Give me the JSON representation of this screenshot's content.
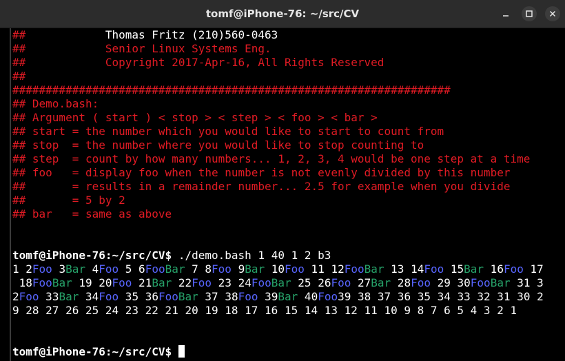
{
  "window": {
    "title": "tomf@iPhone-76: ~/src/CV"
  },
  "colors": {
    "comment_red": "#e01b24",
    "foo_blue": "#5865ff",
    "bar_green": "#26a269",
    "text_white": "#ffffff",
    "background": "#000000",
    "titlebar": "#2c2c2c"
  },
  "controls": {
    "icons": [
      "minimize-icon",
      "maximize-icon",
      "close-icon"
    ]
  },
  "terminal": {
    "lines": [
      [
        {
          "t": "##            ",
          "c": "r"
        },
        {
          "t": "Thomas Fritz (210)560-0463",
          "c": "w"
        }
      ],
      [
        {
          "t": "##            Senior Linux Systems Eng.",
          "c": "r"
        }
      ],
      [
        {
          "t": "##            Copyright 2017-Apr-16, All Rights Reserved",
          "c": "r"
        }
      ],
      [
        {
          "t": "##",
          "c": "r"
        }
      ],
      [
        {
          "t": "##################################################################",
          "c": "r"
        }
      ],
      [
        {
          "t": "## Demo.bash:",
          "c": "r"
        }
      ],
      [
        {
          "t": "## Argument ( start ) < stop > < step > < foo > < bar >",
          "c": "r"
        }
      ],
      [
        {
          "t": "## start = the number which you would like to start to count from",
          "c": "r"
        }
      ],
      [
        {
          "t": "## stop  = the number where you would like to stop counting to",
          "c": "r"
        }
      ],
      [
        {
          "t": "## step  = count by how many numbers... 1, 2, 3, 4 would be one step at a time",
          "c": "r"
        }
      ],
      [
        {
          "t": "## foo   = display foo when the number is not evenly divided by this number",
          "c": "r"
        }
      ],
      [
        {
          "t": "##       = results in a remainder number... 2.5 for example when you divide",
          "c": "r"
        }
      ],
      [
        {
          "t": "##       = 5 by 2",
          "c": "r"
        }
      ],
      [
        {
          "t": "## bar   = same as above",
          "c": "r"
        }
      ],
      [],
      [],
      [
        {
          "t": "tomf@iPhone-76:~/src/CV$ ",
          "c": "wb"
        },
        {
          "t": "./demo.bash 1 40 1 2 b3",
          "c": "w"
        }
      ],
      [
        {
          "t": "1 2",
          "c": "w"
        },
        {
          "t": "Foo",
          "c": "b"
        },
        {
          "t": " 3",
          "c": "w"
        },
        {
          "t": "Bar",
          "c": "g"
        },
        {
          "t": " 4",
          "c": "w"
        },
        {
          "t": "Foo",
          "c": "b"
        },
        {
          "t": " 5 6",
          "c": "w"
        },
        {
          "t": "Foo",
          "c": "b"
        },
        {
          "t": "Bar",
          "c": "g"
        },
        {
          "t": " 7 8",
          "c": "w"
        },
        {
          "t": "Foo",
          "c": "b"
        },
        {
          "t": " 9",
          "c": "w"
        },
        {
          "t": "Bar",
          "c": "g"
        },
        {
          "t": " 10",
          "c": "w"
        },
        {
          "t": "Foo",
          "c": "b"
        },
        {
          "t": " 11 12",
          "c": "w"
        },
        {
          "t": "Foo",
          "c": "b"
        },
        {
          "t": "Bar",
          "c": "g"
        },
        {
          "t": " 13 14",
          "c": "w"
        },
        {
          "t": "Foo",
          "c": "b"
        },
        {
          "t": " 15",
          "c": "w"
        },
        {
          "t": "Bar",
          "c": "g"
        },
        {
          "t": " 16",
          "c": "w"
        },
        {
          "t": "Foo",
          "c": "b"
        },
        {
          "t": " 17",
          "c": "w"
        }
      ],
      [
        {
          "t": " 18",
          "c": "w"
        },
        {
          "t": "Foo",
          "c": "b"
        },
        {
          "t": "Bar",
          "c": "g"
        },
        {
          "t": " 19 20",
          "c": "w"
        },
        {
          "t": "Foo",
          "c": "b"
        },
        {
          "t": " 21",
          "c": "w"
        },
        {
          "t": "Bar",
          "c": "g"
        },
        {
          "t": " 22",
          "c": "w"
        },
        {
          "t": "Foo",
          "c": "b"
        },
        {
          "t": " 23 24",
          "c": "w"
        },
        {
          "t": "Foo",
          "c": "b"
        },
        {
          "t": "Bar",
          "c": "g"
        },
        {
          "t": " 25 26",
          "c": "w"
        },
        {
          "t": "Foo",
          "c": "b"
        },
        {
          "t": " 27",
          "c": "w"
        },
        {
          "t": "Bar",
          "c": "g"
        },
        {
          "t": " 28",
          "c": "w"
        },
        {
          "t": "Foo",
          "c": "b"
        },
        {
          "t": " 29 30",
          "c": "w"
        },
        {
          "t": "Foo",
          "c": "b"
        },
        {
          "t": "Bar",
          "c": "g"
        },
        {
          "t": " 31 3",
          "c": "w"
        }
      ],
      [
        {
          "t": "2",
          "c": "w"
        },
        {
          "t": "Foo",
          "c": "b"
        },
        {
          "t": " 33",
          "c": "w"
        },
        {
          "t": "Bar",
          "c": "g"
        },
        {
          "t": " 34",
          "c": "w"
        },
        {
          "t": "Foo",
          "c": "b"
        },
        {
          "t": " 35 36",
          "c": "w"
        },
        {
          "t": "Foo",
          "c": "b"
        },
        {
          "t": "Bar",
          "c": "g"
        },
        {
          "t": " 37 38",
          "c": "w"
        },
        {
          "t": "Foo",
          "c": "b"
        },
        {
          "t": " 39",
          "c": "w"
        },
        {
          "t": "Bar",
          "c": "g"
        },
        {
          "t": " 40",
          "c": "w"
        },
        {
          "t": "Foo",
          "c": "b"
        },
        {
          "t": "39 38 37 36 35 34 33 32 31 30 2",
          "c": "w"
        }
      ],
      [
        {
          "t": "9 28 27 26 25 24 23 22 21 20 19 18 17 16 15 14 13 12 11 10 9 8 7 6 5 4 3 2 1",
          "c": "w"
        }
      ],
      [],
      [],
      [
        {
          "t": "tomf@iPhone-76:~/src/CV$ ",
          "c": "wb"
        },
        {
          "cursor": true
        }
      ]
    ]
  }
}
